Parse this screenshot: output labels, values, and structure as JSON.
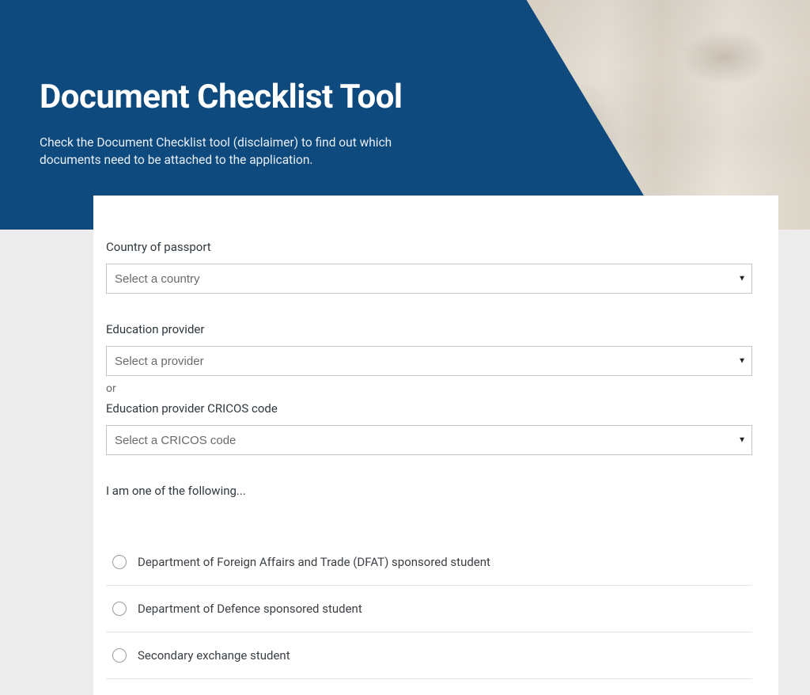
{
  "hero": {
    "title": "Document Checklist Tool",
    "subtitle": "Check the Document Checklist tool (disclaimer) to find out which documents need to be attached to the application."
  },
  "form": {
    "country": {
      "label": "Country of passport",
      "placeholder": "Select a country"
    },
    "provider": {
      "label": "Education provider",
      "placeholder": "Select a provider"
    },
    "or": "or",
    "cricos": {
      "label": "Education provider CRICOS code",
      "placeholder": "Select a CRICOS code"
    },
    "following_heading": "I am one of the following...",
    "options": [
      {
        "label": "Department of Foreign Affairs and Trade (DFAT) sponsored student"
      },
      {
        "label": "Department of Defence sponsored student"
      },
      {
        "label": "Secondary exchange student"
      }
    ]
  }
}
